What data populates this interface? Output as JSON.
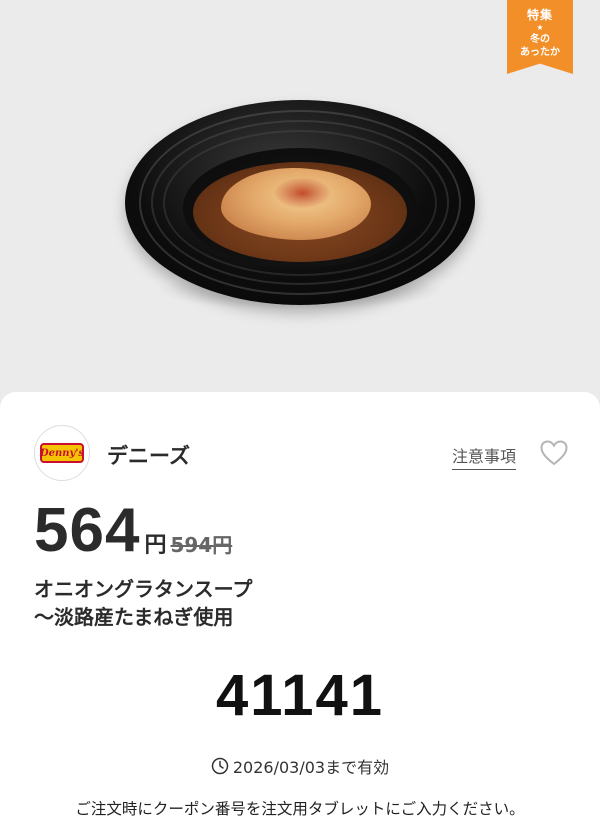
{
  "badge": {
    "top": "特集",
    "star": "★",
    "line1": "冬の",
    "line2": "あったか"
  },
  "brand": {
    "name": "デニーズ",
    "logo_text": "Denny's"
  },
  "links": {
    "notes": "注意事項"
  },
  "icons": {
    "favorite": "heart-outline-icon",
    "expiry": "clock-icon"
  },
  "price": {
    "current": "564",
    "currency": "円",
    "original": "594円"
  },
  "product": {
    "name_line1": "オニオングラタンスープ",
    "name_line2": "〜淡路産たまねぎ使用"
  },
  "coupon": {
    "code": "41141",
    "expiry": "2026/03/03まで有効",
    "instruction": "ご注文時にクーポン番号を注文用タブレットにご入力ください。"
  },
  "colors": {
    "badge": "#f28f28",
    "logo_yellow": "#f5c400",
    "logo_red": "#c8102e"
  }
}
